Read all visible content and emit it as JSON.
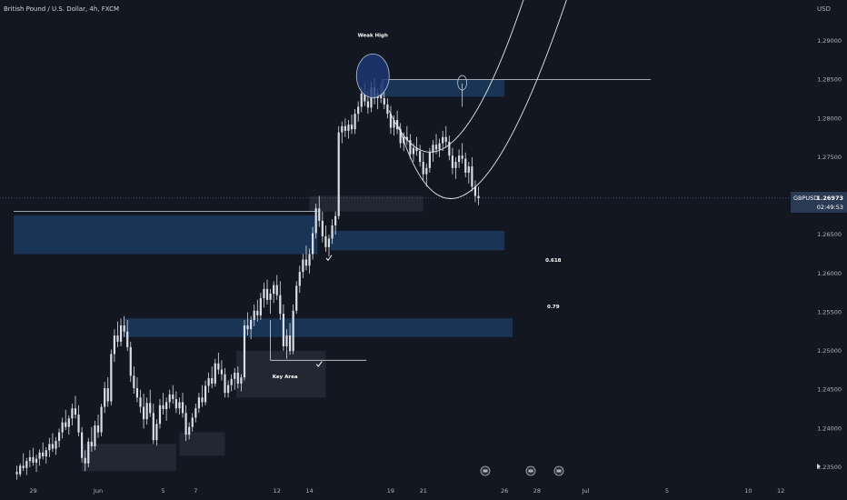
{
  "header": {
    "title": "British Pound / U.S. Dollar, 4h, FXCM",
    "currency": "USD"
  },
  "price_label": {
    "symbol": "GBPUSD",
    "price": "1.26973",
    "countdown": "02:49:53"
  },
  "colors": {
    "background": "#131722",
    "candle": "#d9dde6",
    "zone_blue": "#1c3a5e",
    "zone_gray": "#2a2e39",
    "line": "#d1d4dc"
  },
  "chart_data": {
    "type": "candlestick",
    "title": "British Pound / U.S. Dollar, 4h, FXCM",
    "ylim": [
      1.233,
      1.3025
    ],
    "yticks": [
      1.235,
      1.24,
      1.245,
      1.25,
      1.255,
      1.26,
      1.265,
      1.27,
      1.275,
      1.28,
      1.285,
      1.29
    ],
    "ytick_labels": [
      "1.23500",
      "1.24000",
      "1.24500",
      "1.25000",
      "1.25500",
      "1.26000",
      "1.26500",
      "1.27000",
      "1.27500",
      "1.28000",
      "1.28500",
      "1.29000"
    ],
    "x_ticks": [
      {
        "label": "29",
        "day": -3
      },
      {
        "label": "Jun",
        "day": 1
      },
      {
        "label": "5",
        "day": 5
      },
      {
        "label": "7",
        "day": 7
      },
      {
        "label": "12",
        "day": 12
      },
      {
        "label": "14",
        "day": 14
      },
      {
        "label": "19",
        "day": 19
      },
      {
        "label": "21",
        "day": 21
      },
      {
        "label": "26",
        "day": 26
      },
      {
        "label": "28",
        "day": 28
      },
      {
        "label": "Jul",
        "day": 31
      },
      {
        "label": "5",
        "day": 36
      },
      {
        "label": "10",
        "day": 41
      },
      {
        "label": "12",
        "day": 43
      }
    ],
    "current_price": 1.26973,
    "annotations": [
      {
        "text": "Weak High",
        "day": 17.9,
        "price": 1.2905
      },
      {
        "text": "Key Area",
        "day": 12.5,
        "price": 1.2465
      },
      {
        "text": "0.618",
        "day": 29,
        "price": 1.2615
      },
      {
        "text": "0.79",
        "day": 29,
        "price": 1.2555
      }
    ],
    "zones": [
      {
        "kind": "blue",
        "d1": -4.2,
        "d2": 14.5,
        "p1": 1.2675,
        "p2": 1.2625
      },
      {
        "kind": "blue",
        "d1": 15.3,
        "d2": 26.0,
        "p1": 1.2655,
        "p2": 1.263
      },
      {
        "kind": "blue",
        "d1": 18.5,
        "d2": 26.0,
        "p1": 1.285,
        "p2": 1.2828
      },
      {
        "kind": "blue",
        "d1": 2.6,
        "d2": 26.5,
        "p1": 1.2542,
        "p2": 1.2518
      },
      {
        "kind": "gray",
        "d1": 14.0,
        "d2": 21.0,
        "p1": 1.27,
        "p2": 1.268
      },
      {
        "kind": "gray",
        "d1": 9.5,
        "d2": 15.0,
        "p1": 1.25,
        "p2": 1.244
      },
      {
        "kind": "gray",
        "d1": 6.0,
        "d2": 8.8,
        "p1": 1.2395,
        "p2": 1.2365
      },
      {
        "kind": "gray",
        "d1": 0.0,
        "d2": 5.8,
        "p1": 1.238,
        "p2": 1.2345
      }
    ],
    "lines": [
      {
        "d1": 18.5,
        "p1": 1.285,
        "d2": 35.0,
        "p2": 1.285
      },
      {
        "d1": -4.2,
        "p1": 1.268,
        "d2": 14.5,
        "p2": 1.268
      },
      {
        "d1": 11.6,
        "p1": 1.2488,
        "d2": 17.5,
        "p2": 1.2488
      },
      {
        "d1": 11.6,
        "p1": 1.2488,
        "d2": 11.6,
        "p2": 1.254
      },
      {
        "d1": 18.5,
        "p1": 1.285,
        "d2": 18.5,
        "p2": 1.283
      },
      {
        "d1": 23.4,
        "p1": 1.2815,
        "d2": 23.4,
        "p2": 1.2845
      }
    ],
    "circles": [
      {
        "day": 17.9,
        "price": 1.2855,
        "rx": 18,
        "ry": 24,
        "filled": true
      },
      {
        "day": 23.4,
        "price": 1.2846,
        "rx": 5,
        "ry": 8,
        "filled": false
      }
    ],
    "curves": [
      {
        "points": [
          [
            18.9,
            1.281
          ],
          [
            23.0,
            1.2625
          ],
          [
            29.0,
            1.308
          ]
        ]
      },
      {
        "points": [
          [
            19.5,
            1.279
          ],
          [
            23.5,
            1.252
          ],
          [
            31.0,
            1.303
          ]
        ]
      }
    ],
    "checkmarks": [
      {
        "day": 15.2,
        "price": 1.262
      },
      {
        "day": 14.6,
        "price": 1.2483
      }
    ],
    "candles": [
      [
        -4.0,
        1.2344,
        1.2352,
        1.2334,
        1.2341
      ],
      [
        -3.8,
        1.2341,
        1.2355,
        1.2338,
        1.2352
      ],
      [
        -3.6,
        1.2352,
        1.2368,
        1.2345,
        1.2349
      ],
      [
        -3.4,
        1.2349,
        1.2362,
        1.234,
        1.2358
      ],
      [
        -3.2,
        1.2358,
        1.2372,
        1.235,
        1.2363
      ],
      [
        -3.0,
        1.2363,
        1.2375,
        1.2352,
        1.2356
      ],
      [
        -2.8,
        1.2356,
        1.2366,
        1.2344,
        1.2361
      ],
      [
        -2.6,
        1.2361,
        1.2373,
        1.2352,
        1.2369
      ],
      [
        -2.4,
        1.2369,
        1.2382,
        1.236,
        1.2364
      ],
      [
        -2.2,
        1.2364,
        1.2376,
        1.2355,
        1.2372
      ],
      [
        -2.0,
        1.2372,
        1.2388,
        1.2363,
        1.238
      ],
      [
        -1.8,
        1.238,
        1.2394,
        1.237,
        1.2374
      ],
      [
        -1.6,
        1.2374,
        1.2389,
        1.2366,
        1.2384
      ],
      [
        -1.4,
        1.2384,
        1.24,
        1.2376,
        1.2395
      ],
      [
        -1.2,
        1.2395,
        1.2414,
        1.2387,
        1.2408
      ],
      [
        -1.0,
        1.2408,
        1.2424,
        1.2398,
        1.2402
      ],
      [
        -0.8,
        1.2402,
        1.2417,
        1.2392,
        1.2413
      ],
      [
        -0.6,
        1.2413,
        1.2432,
        1.2404,
        1.2426
      ],
      [
        -0.4,
        1.2426,
        1.2442,
        1.2413,
        1.2418
      ],
      [
        -0.2,
        1.2418,
        1.243,
        1.239,
        1.2395
      ],
      [
        0.0,
        1.2395,
        1.2402,
        1.2356,
        1.2362
      ],
      [
        0.2,
        1.2362,
        1.2372,
        1.2345,
        1.2355
      ],
      [
        0.4,
        1.2355,
        1.2388,
        1.235,
        1.2383
      ],
      [
        0.6,
        1.2383,
        1.2402,
        1.237,
        1.2377
      ],
      [
        0.8,
        1.2377,
        1.241,
        1.2372,
        1.2404
      ],
      [
        1.0,
        1.2404,
        1.2418,
        1.2388,
        1.2395
      ],
      [
        1.2,
        1.2395,
        1.2432,
        1.239,
        1.2428
      ],
      [
        1.4,
        1.2428,
        1.246,
        1.242,
        1.2452
      ],
      [
        1.6,
        1.2452,
        1.2466,
        1.2428,
        1.2435
      ],
      [
        1.8,
        1.2435,
        1.2502,
        1.243,
        1.2496
      ],
      [
        2.0,
        1.2496,
        1.2528,
        1.2486,
        1.252
      ],
      [
        2.2,
        1.252,
        1.2538,
        1.2505,
        1.2512
      ],
      [
        2.4,
        1.2512,
        1.2542,
        1.2506,
        1.2533
      ],
      [
        2.6,
        1.2533,
        1.2545,
        1.2518,
        1.2525
      ],
      [
        2.8,
        1.2525,
        1.254,
        1.25,
        1.2505
      ],
      [
        3.0,
        1.2505,
        1.2512,
        1.246,
        1.2468
      ],
      [
        3.2,
        1.2468,
        1.248,
        1.2445,
        1.2452
      ],
      [
        3.4,
        1.2452,
        1.2466,
        1.2434,
        1.244
      ],
      [
        3.6,
        1.244,
        1.245,
        1.242,
        1.2428
      ],
      [
        3.8,
        1.2428,
        1.2445,
        1.24,
        1.2412
      ],
      [
        4.0,
        1.2412,
        1.244,
        1.2405,
        1.2433
      ],
      [
        4.2,
        1.2433,
        1.245,
        1.2415,
        1.242
      ],
      [
        4.4,
        1.242,
        1.2432,
        1.238,
        1.2385
      ],
      [
        4.6,
        1.2385,
        1.2412,
        1.2378,
        1.2406
      ],
      [
        4.8,
        1.2406,
        1.2438,
        1.24,
        1.243
      ],
      [
        5.0,
        1.243,
        1.2446,
        1.2418,
        1.2425
      ],
      [
        5.2,
        1.2425,
        1.244,
        1.241,
        1.2434
      ],
      [
        5.4,
        1.2434,
        1.245,
        1.2426,
        1.2444
      ],
      [
        5.6,
        1.2444,
        1.2456,
        1.2432,
        1.2438
      ],
      [
        5.8,
        1.2438,
        1.2448,
        1.242,
        1.2426
      ],
      [
        6.0,
        1.2426,
        1.244,
        1.2418,
        1.2434
      ],
      [
        6.2,
        1.2434,
        1.2446,
        1.2414,
        1.242
      ],
      [
        6.4,
        1.242,
        1.243,
        1.2384,
        1.2392
      ],
      [
        6.6,
        1.2392,
        1.2408,
        1.2386,
        1.2402
      ],
      [
        6.8,
        1.2402,
        1.242,
        1.2396,
        1.2414
      ],
      [
        7.0,
        1.2414,
        1.2432,
        1.2408,
        1.2426
      ],
      [
        7.2,
        1.2426,
        1.2446,
        1.242,
        1.244
      ],
      [
        7.4,
        1.244,
        1.2456,
        1.2428,
        1.2434
      ],
      [
        7.6,
        1.2434,
        1.2462,
        1.243,
        1.2455
      ],
      [
        7.8,
        1.2455,
        1.2472,
        1.2446,
        1.2465
      ],
      [
        8.0,
        1.2465,
        1.248,
        1.2452,
        1.2458
      ],
      [
        8.2,
        1.2458,
        1.249,
        1.2454,
        1.2484
      ],
      [
        8.4,
        1.2484,
        1.2498,
        1.247,
        1.2476
      ],
      [
        8.6,
        1.2476,
        1.2488,
        1.2462,
        1.247
      ],
      [
        8.8,
        1.247,
        1.2478,
        1.244,
        1.2446
      ],
      [
        9.0,
        1.2446,
        1.2462,
        1.244,
        1.2456
      ],
      [
        9.2,
        1.2456,
        1.247,
        1.2448,
        1.2464
      ],
      [
        9.4,
        1.2464,
        1.2478,
        1.245,
        1.2472
      ],
      [
        9.6,
        1.2472,
        1.248,
        1.2452,
        1.2458
      ],
      [
        9.8,
        1.2458,
        1.247,
        1.2448,
        1.2466
      ],
      [
        10.0,
        1.2466,
        1.254,
        1.2462,
        1.2533
      ],
      [
        10.2,
        1.2533,
        1.255,
        1.252,
        1.2528
      ],
      [
        10.4,
        1.2528,
        1.2545,
        1.2515,
        1.254
      ],
      [
        10.6,
        1.254,
        1.256,
        1.2532,
        1.2552
      ],
      [
        10.8,
        1.2552,
        1.2566,
        1.2538,
        1.2546
      ],
      [
        11.0,
        1.2546,
        1.2575,
        1.254,
        1.2568
      ],
      [
        11.2,
        1.2568,
        1.2588,
        1.2556,
        1.258
      ],
      [
        11.4,
        1.258,
        1.2592,
        1.256,
        1.2566
      ],
      [
        11.6,
        1.2566,
        1.258,
        1.2548,
        1.2574
      ],
      [
        11.8,
        1.2574,
        1.259,
        1.2562,
        1.2585
      ],
      [
        12.0,
        1.2585,
        1.2598,
        1.2566,
        1.2572
      ],
      [
        12.2,
        1.2572,
        1.259,
        1.254,
        1.2548
      ],
      [
        12.4,
        1.2548,
        1.256,
        1.25,
        1.2506
      ],
      [
        12.6,
        1.2506,
        1.2528,
        1.249,
        1.252
      ],
      [
        12.8,
        1.252,
        1.2536,
        1.2495,
        1.25
      ],
      [
        13.0,
        1.25,
        1.256,
        1.2496,
        1.2552
      ],
      [
        13.2,
        1.2552,
        1.259,
        1.2548,
        1.2584
      ],
      [
        13.4,
        1.2584,
        1.261,
        1.2575,
        1.2602
      ],
      [
        13.6,
        1.2602,
        1.2625,
        1.2594,
        1.2618
      ],
      [
        13.8,
        1.2618,
        1.2636,
        1.2604,
        1.261
      ],
      [
        14.0,
        1.261,
        1.2632,
        1.26,
        1.2625
      ],
      [
        14.2,
        1.2625,
        1.266,
        1.2618,
        1.2652
      ],
      [
        14.4,
        1.2652,
        1.269,
        1.2645,
        1.2684
      ],
      [
        14.6,
        1.2684,
        1.27,
        1.266,
        1.2668
      ],
      [
        14.8,
        1.2668,
        1.268,
        1.264,
        1.2648
      ],
      [
        15.0,
        1.2648,
        1.2662,
        1.2628,
        1.2634
      ],
      [
        15.2,
        1.2634,
        1.265,
        1.2622,
        1.2645
      ],
      [
        15.4,
        1.2645,
        1.267,
        1.2638,
        1.2662
      ],
      [
        15.6,
        1.2662,
        1.268,
        1.265,
        1.2674
      ],
      [
        15.8,
        1.2674,
        1.279,
        1.267,
        1.2782
      ],
      [
        16.0,
        1.2782,
        1.2796,
        1.2768,
        1.279
      ],
      [
        16.2,
        1.279,
        1.28,
        1.2776,
        1.2784
      ],
      [
        16.4,
        1.2784,
        1.2798,
        1.2774,
        1.2792
      ],
      [
        16.6,
        1.2792,
        1.2805,
        1.278,
        1.2786
      ],
      [
        16.8,
        1.2786,
        1.2812,
        1.278,
        1.2806
      ],
      [
        17.0,
        1.2806,
        1.2822,
        1.2796,
        1.2815
      ],
      [
        17.2,
        1.2815,
        1.284,
        1.2808,
        1.2832
      ],
      [
        17.4,
        1.2832,
        1.2845,
        1.2816,
        1.2822
      ],
      [
        17.6,
        1.2822,
        1.2836,
        1.2806,
        1.2814
      ],
      [
        17.8,
        1.2814,
        1.2848,
        1.2808,
        1.284
      ],
      [
        18.0,
        1.284,
        1.2852,
        1.2818,
        1.2826
      ],
      [
        18.2,
        1.2826,
        1.2838,
        1.2812,
        1.2832
      ],
      [
        18.4,
        1.2832,
        1.2846,
        1.282,
        1.2826
      ],
      [
        18.6,
        1.2826,
        1.2834,
        1.2812,
        1.2818
      ],
      [
        18.8,
        1.2818,
        1.2826,
        1.28,
        1.2806
      ],
      [
        19.0,
        1.2806,
        1.2816,
        1.278,
        1.2788
      ],
      [
        19.2,
        1.2788,
        1.2804,
        1.2778,
        1.2798
      ],
      [
        19.4,
        1.2798,
        1.281,
        1.278,
        1.2786
      ],
      [
        19.6,
        1.2786,
        1.2794,
        1.2762,
        1.2768
      ],
      [
        19.8,
        1.2768,
        1.2782,
        1.2758,
        1.2776
      ],
      [
        20.0,
        1.2776,
        1.279,
        1.2766,
        1.2772
      ],
      [
        20.2,
        1.2772,
        1.278,
        1.2748,
        1.2754
      ],
      [
        20.4,
        1.2754,
        1.2768,
        1.2744,
        1.2762
      ],
      [
        20.6,
        1.2762,
        1.2776,
        1.2752,
        1.2758
      ],
      [
        20.8,
        1.2758,
        1.2766,
        1.2738,
        1.2744
      ],
      [
        21.0,
        1.2744,
        1.2756,
        1.272,
        1.2728
      ],
      [
        21.2,
        1.2728,
        1.2742,
        1.2712,
        1.2736
      ],
      [
        21.4,
        1.2736,
        1.2762,
        1.273,
        1.2756
      ],
      [
        21.6,
        1.2756,
        1.2772,
        1.2744,
        1.2766
      ],
      [
        21.8,
        1.2766,
        1.278,
        1.2754,
        1.276
      ],
      [
        22.0,
        1.276,
        1.2774,
        1.275,
        1.2768
      ],
      [
        22.2,
        1.2768,
        1.2784,
        1.2758,
        1.2776
      ],
      [
        22.4,
        1.2776,
        1.279,
        1.2762,
        1.277
      ],
      [
        22.6,
        1.277,
        1.2778,
        1.2746,
        1.2752
      ],
      [
        22.8,
        1.2752,
        1.2762,
        1.2728,
        1.2736
      ],
      [
        23.0,
        1.2736,
        1.275,
        1.2722,
        1.2744
      ],
      [
        23.2,
        1.2744,
        1.276,
        1.2736,
        1.2752
      ],
      [
        23.4,
        1.2752,
        1.2768,
        1.2742,
        1.2748
      ],
      [
        23.6,
        1.2748,
        1.2756,
        1.2724,
        1.273
      ],
      [
        23.8,
        1.273,
        1.2744,
        1.2716,
        1.2738
      ],
      [
        24.0,
        1.2738,
        1.275,
        1.2706,
        1.2712
      ],
      [
        24.2,
        1.2712,
        1.272,
        1.2692,
        1.27
      ],
      [
        24.4,
        1.27,
        1.2712,
        1.2688,
        1.2697
      ]
    ]
  }
}
